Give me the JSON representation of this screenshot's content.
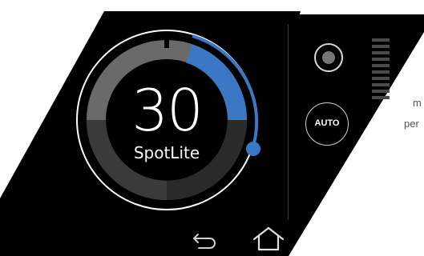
{
  "dial": {
    "value": "30",
    "label": "SpotLite",
    "fraction": 0.3
  },
  "controls": {
    "mode_icon": "record-dot-icon",
    "auto_label": "AUTO"
  },
  "level_meter": {
    "segments": 10
  },
  "nav": {
    "back_icon": "back-arrow-icon",
    "home_icon": "home-icon"
  },
  "side_text": {
    "line1": "m",
    "line2": "per"
  },
  "colors": {
    "accent": "#3a78c6",
    "background": "#000000",
    "ring": "#ffffff",
    "track": "#6f6f6f"
  }
}
